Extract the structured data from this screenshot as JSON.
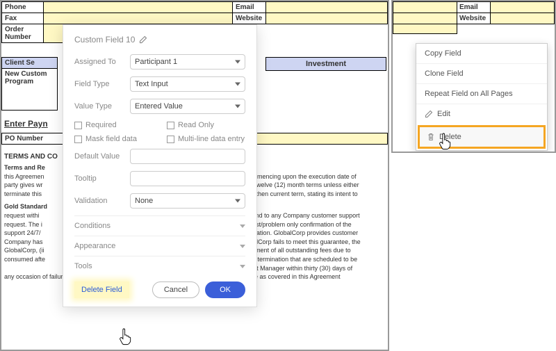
{
  "form": {
    "phone": "Phone",
    "fax": "Fax",
    "order_no": "Order Number",
    "email": "Email",
    "website": "Website"
  },
  "section_client": "Client Se",
  "investment": "Investment",
  "client_row": "New Custom\nProgram",
  "enter_pay": "Enter Payn",
  "po": "PO Number",
  "terms_hdr": "TERMS AND CO",
  "para1": {
    "lead": "Terms and Re",
    "rest_l": "this Agreemen\nparty gives wr\nterminate this",
    "rest_r": "s, commencing upon the execution date of\nssive twelve (12) month terms unless either\nof the then current term, stating its intent to"
  },
  "para2": {
    "lead": "Gold Standard",
    "rest_l": "request withi\nrequest. The i\nsupport 24/7/\nCompany has\nGlobalCorp, (ii\nconsumed afte",
    "rest_r": "respond to any Company customer support\n request/problem only confirmation of the\nmunication. GlobalCorp provides customer\nGlobalCorp fails to meet this guarantee, the\nn payment of all outstanding fees due to\nrior to termination that are scheduled to be\nccount Manager within thirty (30) days of",
    "tail": "any occasion of failure to meet this guarantee.  Temporary shut downs due to Force Majeure as covered in this Agreement"
  },
  "panel": {
    "title": "Custom Field 10",
    "assigned": "Assigned To",
    "assigned_v": "Participant 1",
    "fieldtype": "Field Type",
    "fieldtype_v": "Text Input",
    "valuetype": "Value Type",
    "valuetype_v": "Entered Value",
    "required": "Required",
    "readonly": "Read Only",
    "mask": "Mask field data",
    "multiline": "Multi-line data entry",
    "default": "Default Value",
    "tooltip": "Tooltip",
    "validation": "Validation",
    "validation_v": "None",
    "conditions": "Conditions",
    "appearance": "Appearance",
    "tools": "Tools",
    "delete": "Delete Field",
    "cancel": "Cancel",
    "ok": "OK"
  },
  "ctx": {
    "copy": "Copy Field",
    "clone": "Clone Field",
    "repeat": "Repeat Field on All Pages",
    "edit": "Edit",
    "delete": "Delete"
  }
}
